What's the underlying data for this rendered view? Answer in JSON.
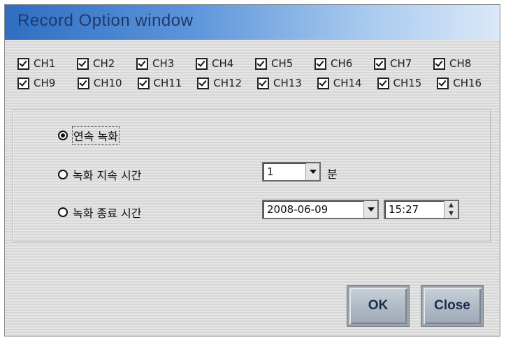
{
  "window": {
    "title": "Record Option window"
  },
  "channels": {
    "row1": [
      {
        "label": "CH1",
        "checked": true
      },
      {
        "label": "CH2",
        "checked": true
      },
      {
        "label": "CH3",
        "checked": true
      },
      {
        "label": "CH4",
        "checked": true
      },
      {
        "label": "CH5",
        "checked": true
      },
      {
        "label": "CH6",
        "checked": true
      },
      {
        "label": "CH7",
        "checked": true
      },
      {
        "label": "CH8",
        "checked": true
      }
    ],
    "row2": [
      {
        "label": "CH9",
        "checked": true
      },
      {
        "label": "CH10",
        "checked": true
      },
      {
        "label": "CH11",
        "checked": true
      },
      {
        "label": "CH12",
        "checked": true
      },
      {
        "label": "CH13",
        "checked": true
      },
      {
        "label": "CH14",
        "checked": true
      },
      {
        "label": "CH15",
        "checked": true
      },
      {
        "label": "CH16",
        "checked": true
      }
    ]
  },
  "record_mode": {
    "continuous_label": "연속 녹화",
    "duration_label": "녹화 지속 시간",
    "end_time_label": "녹화 종료 시간",
    "selected": "continuous"
  },
  "duration": {
    "value": "1",
    "unit": "분"
  },
  "end_time": {
    "date": "2008-06-09",
    "time": "15:27"
  },
  "buttons": {
    "ok": "OK",
    "close": "Close"
  },
  "colors": {
    "title_gradient_start": "#2f6ec0",
    "title_gradient_end": "#dbe9f8",
    "title_text": "#22386a",
    "button_text": "#1c2c4c"
  },
  "icons": {
    "checkbox": "checked-checkbox-icon",
    "radio_selected": "radio-selected-icon",
    "radio_unselected": "radio-unselected-icon",
    "dropdown": "chevron-down-icon",
    "spinner": "spinner-icon"
  }
}
